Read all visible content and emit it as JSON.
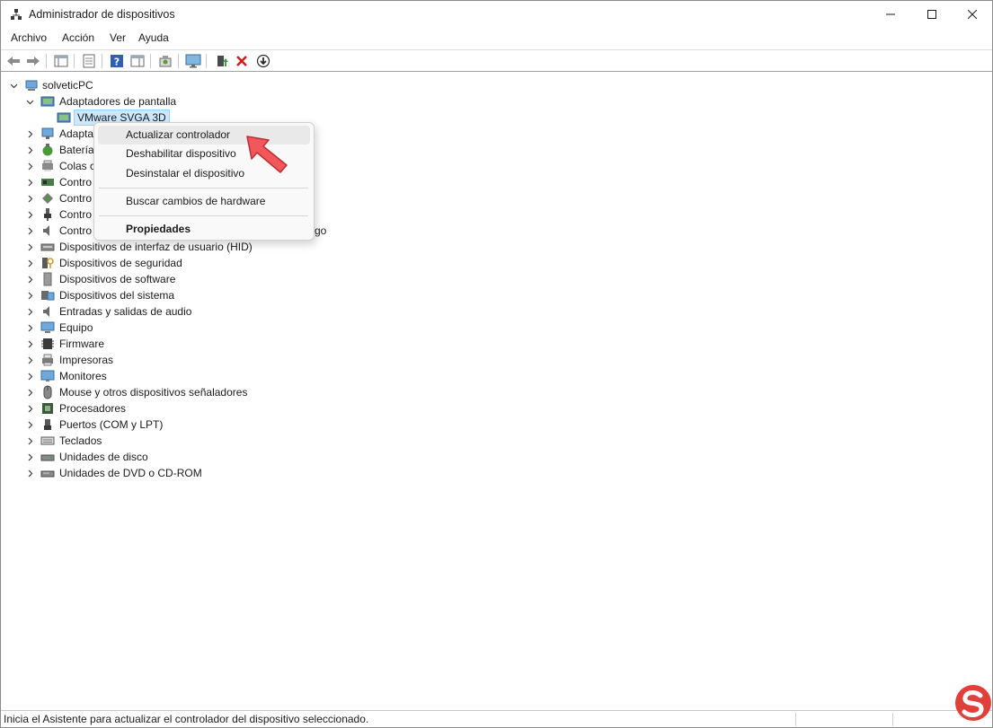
{
  "window": {
    "title": "Administrador de dispositivos",
    "controls": {
      "minimize": "minimize-icon",
      "maximize": "maximize-icon",
      "close": "close-icon"
    }
  },
  "menu": [
    "Archivo",
    "Acción",
    "Ver",
    "Ayuda"
  ],
  "toolbar": {
    "icons": [
      "back-arrow-icon",
      "forward-arrow-icon",
      "show-hide-console-tree-icon",
      "properties-sheet-icon",
      "help-icon",
      "show-action-pane-icon",
      "scan-hardware-icon",
      "monitor-icon",
      "update-driver-icon",
      "uninstall-x-icon",
      "disable-device-icon"
    ]
  },
  "tree": {
    "root": "solveticPC",
    "expanded_category": "Adaptadores de pantalla",
    "selected_device": "VMware SVGA 3D",
    "categories_partial": [
      "Adapta",
      "Batería",
      "Colas c",
      "Contro",
      "Contro",
      "Contro",
      "Contro"
    ],
    "partial_suffix": "go",
    "categories": [
      "Dispositivos de interfaz de usuario (HID)",
      "Dispositivos de seguridad",
      "Dispositivos de software",
      "Dispositivos del sistema",
      "Entradas y salidas de audio",
      "Equipo",
      "Firmware",
      "Impresoras",
      "Monitores",
      "Mouse y otros dispositivos señaladores",
      "Procesadores",
      "Puertos (COM y LPT)",
      "Teclados",
      "Unidades de disco",
      "Unidades de DVD o CD-ROM"
    ]
  },
  "context_menu": {
    "items": {
      "update": "Actualizar controlador",
      "disable": "Deshabilitar dispositivo",
      "uninstall": "Desinstalar el dispositivo",
      "scan": "Buscar cambios de hardware",
      "properties": "Propiedades"
    },
    "highlighted": "Actualizar controlador"
  },
  "statusbar": {
    "text": "Inicia el Asistente para actualizar el controlador del dispositivo seleccionado."
  },
  "colors": {
    "selection_bg": "#cce8ff",
    "annotation_arrow": "#f2585b",
    "watermark": "#e0403a"
  }
}
